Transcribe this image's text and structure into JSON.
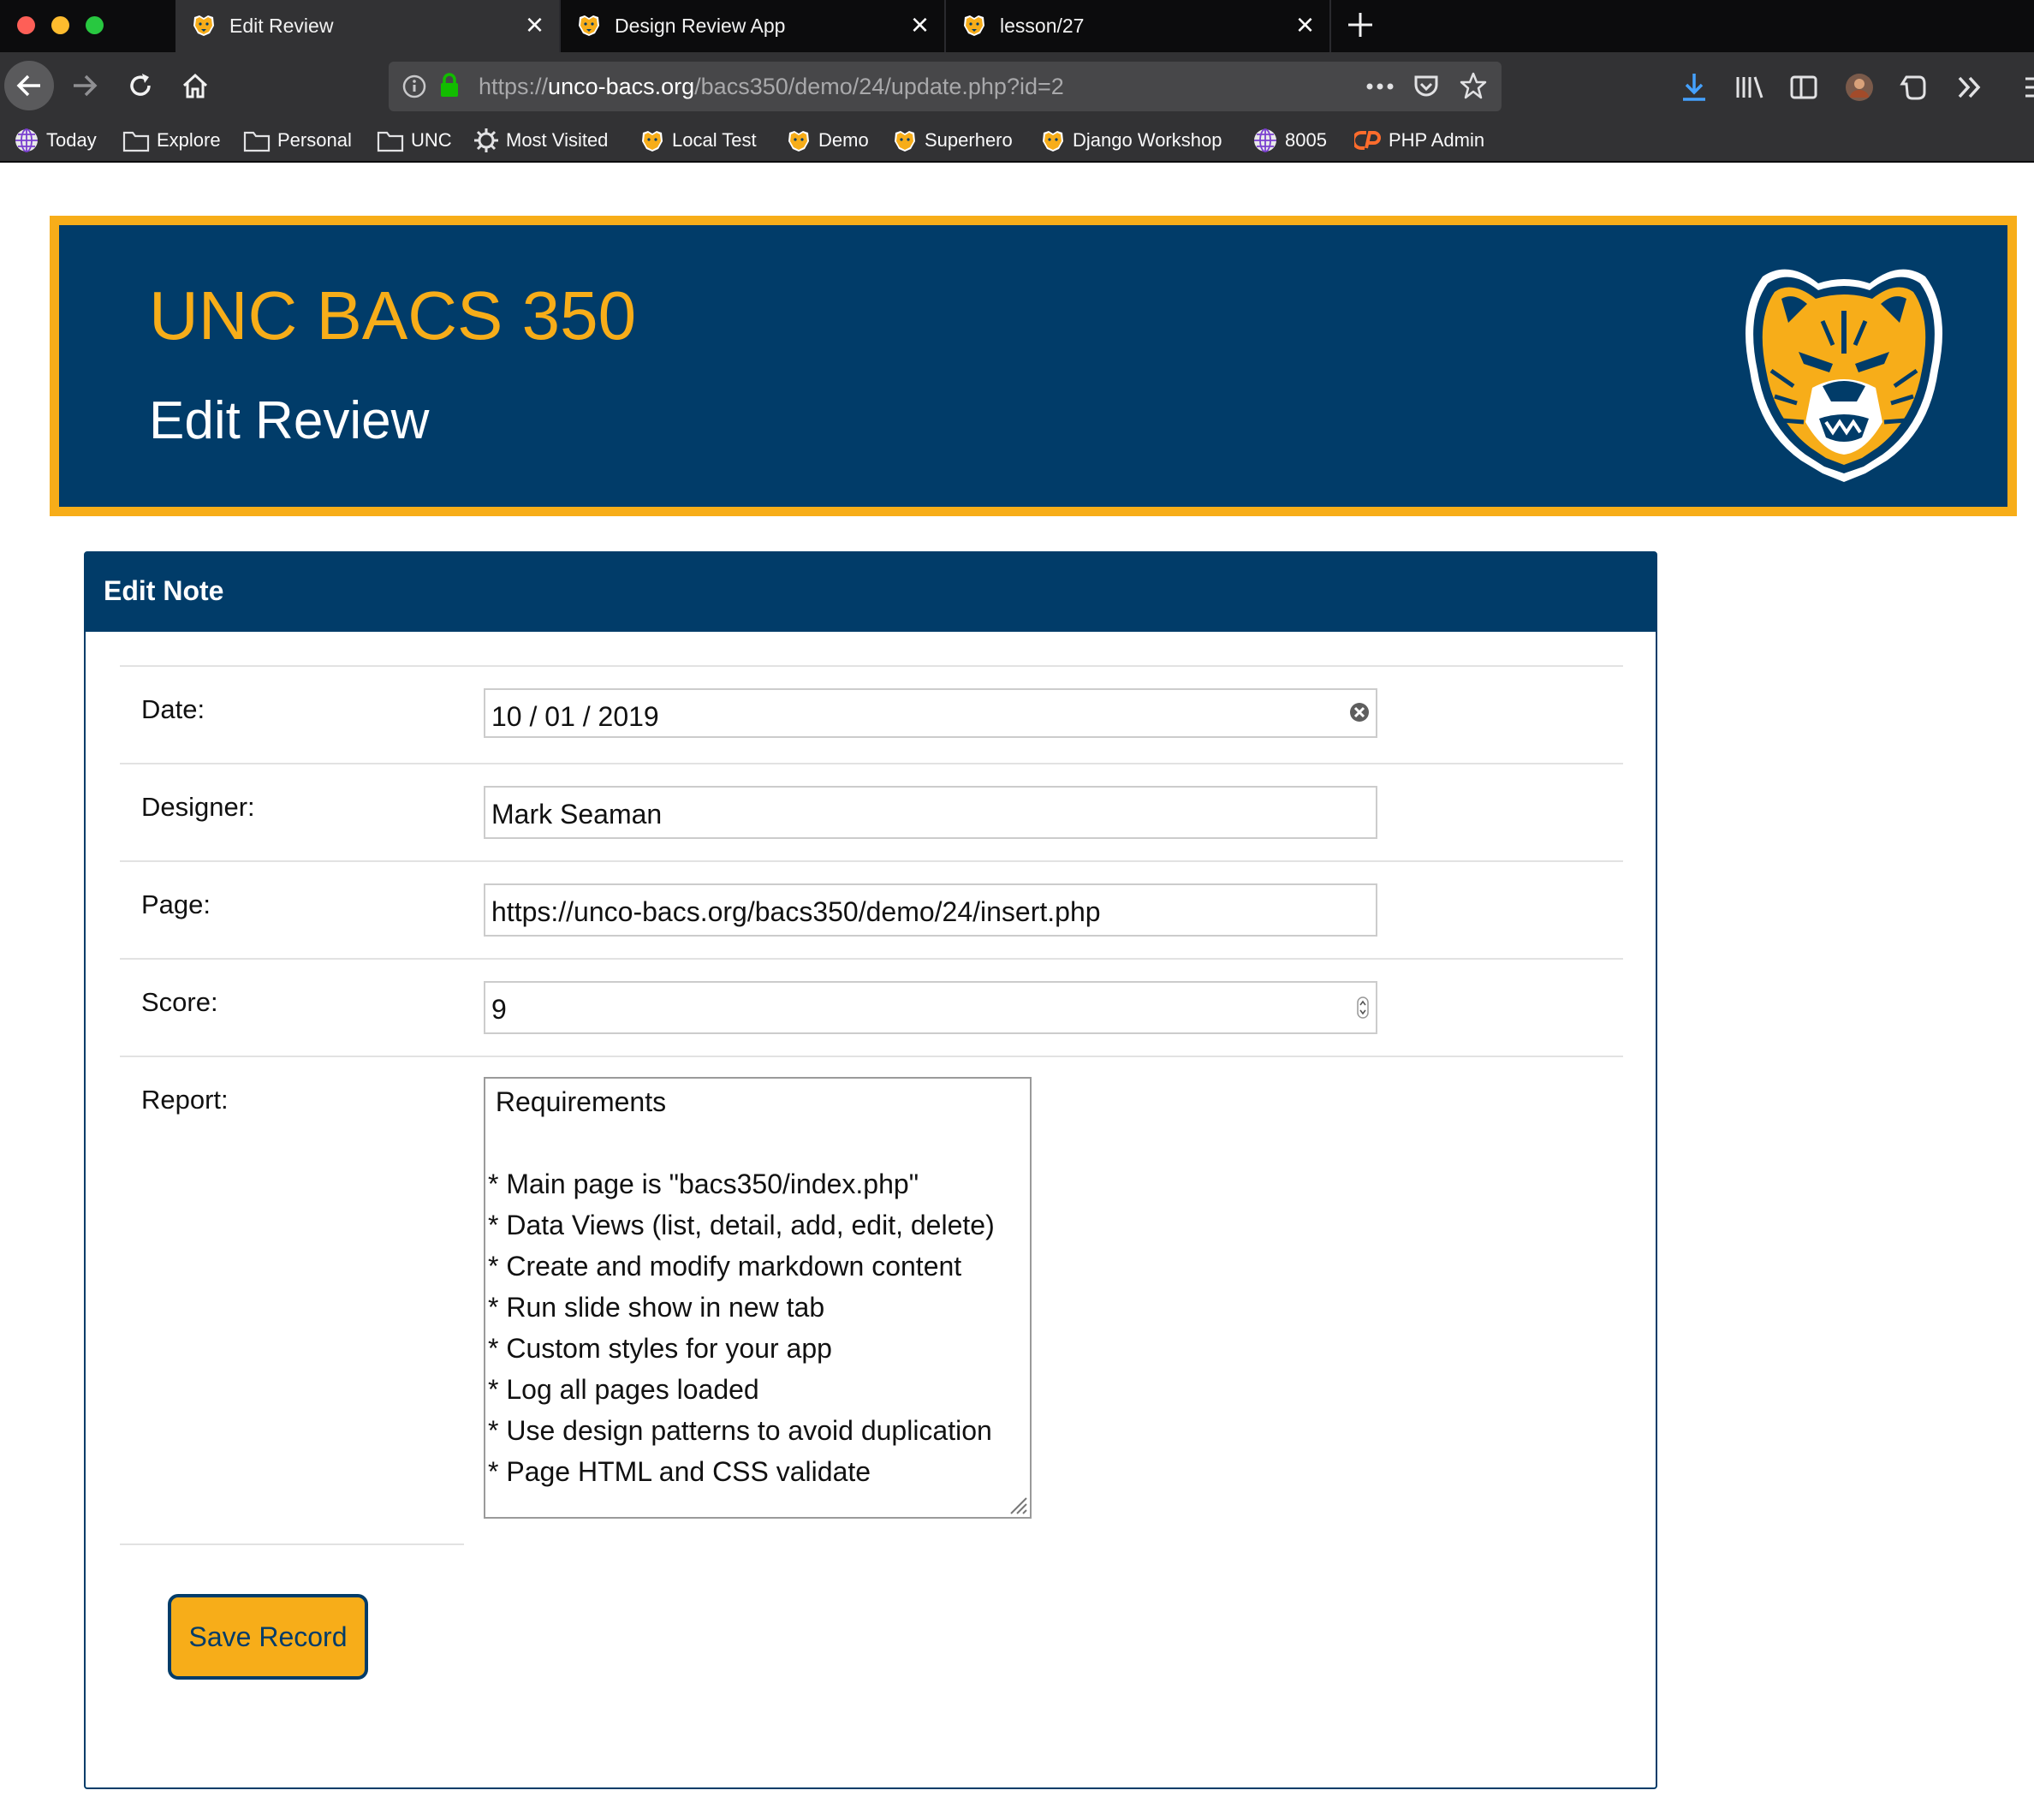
{
  "browser": {
    "tabs": [
      {
        "title": "Edit Review",
        "active": true
      },
      {
        "title": "Design Review App",
        "active": false
      },
      {
        "title": "lesson/27",
        "active": false
      }
    ],
    "url": {
      "prefix": "https://",
      "domain": "unco-bacs.org",
      "path": "/bacs350/demo/24/update.php?id=2"
    },
    "bookmarks": [
      {
        "label": "Today",
        "icon": "globe-icon"
      },
      {
        "label": "Explore",
        "icon": "folder-icon"
      },
      {
        "label": "Personal",
        "icon": "folder-icon"
      },
      {
        "label": "UNC",
        "icon": "folder-icon"
      },
      {
        "label": "Most Visited",
        "icon": "gear-icon"
      },
      {
        "label": "Local Test",
        "icon": "bear-favicon-icon"
      },
      {
        "label": "Demo",
        "icon": "bear-favicon-icon"
      },
      {
        "label": "Superhero",
        "icon": "bear-favicon-icon"
      },
      {
        "label": "Django Workshop",
        "icon": "bear-favicon-icon"
      },
      {
        "label": "8005",
        "icon": "globe-icon"
      },
      {
        "label": "PHP Admin",
        "icon": "cpanel-icon"
      }
    ]
  },
  "header": {
    "site_title": "UNC BACS 350",
    "page_title": "Edit Review"
  },
  "card": {
    "title": "Edit Note",
    "fields": {
      "date": {
        "label": "Date:",
        "value": "10 / 01 / 2019"
      },
      "designer": {
        "label": "Designer:",
        "value": "Mark Seaman"
      },
      "page": {
        "label": "Page:",
        "value": "https://unco-bacs.org/bacs350/demo/24/insert.php"
      },
      "score": {
        "label": "Score:",
        "value": "9"
      },
      "report": {
        "label": "Report:",
        "lines": [
          " Requirements",
          "",
          "* Main page is \"bacs350/index.php\"",
          "* Data Views (list, detail, add, edit, delete)",
          "* Create and modify markdown content",
          "* Run slide show in new tab",
          "* Custom styles for your app",
          "* Log all pages loaded",
          "* Use design patterns to avoid duplication",
          "* Page HTML and CSS validate"
        ]
      }
    },
    "save_label": "Save Record"
  },
  "colors": {
    "navy": "#013c69",
    "gold": "#f7ad19",
    "chrome_dark": "#0c0c0d",
    "chrome": "#323234"
  }
}
